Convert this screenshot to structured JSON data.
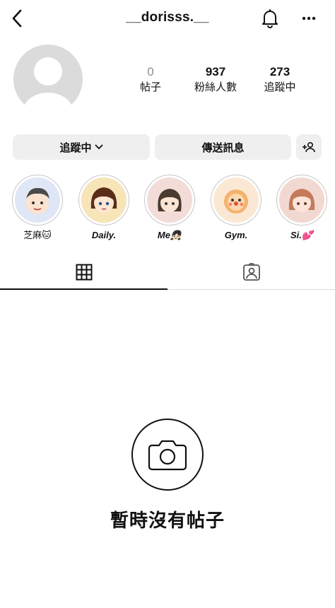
{
  "header": {
    "username": "__dorisss.__",
    "back_icon": "chevron-left-icon",
    "bell_icon": "bell-icon",
    "more_icon": "more-horizontal-icon"
  },
  "profile": {
    "avatar_icon": "default-avatar-icon",
    "stats": [
      {
        "value": "0",
        "label": "帖子"
      },
      {
        "value": "937",
        "label": "粉絲人數"
      },
      {
        "value": "273",
        "label": "追蹤中"
      }
    ]
  },
  "actions": {
    "follow_label": "追蹤中",
    "message_label": "傳送訊息",
    "add_user_icon": "add-user-icon"
  },
  "highlights": [
    {
      "caption": "芝麻🐱",
      "italic": false,
      "bg": "#dfe6f6"
    },
    {
      "caption": "Daily.",
      "italic": true,
      "bg": "#f7e4b7"
    },
    {
      "caption": "Me👧🏻",
      "italic": true,
      "bg": "#f3dcd8"
    },
    {
      "caption": "Gym.",
      "italic": true,
      "bg": "#fbe8d4"
    },
    {
      "caption": "Si.💕",
      "italic": true,
      "bg": "#f1d9d1"
    }
  ],
  "tabs": [
    {
      "name": "grid",
      "icon": "grid-icon",
      "active": true
    },
    {
      "name": "tagged",
      "icon": "tagged-person-icon",
      "active": false
    }
  ],
  "empty_state": {
    "icon": "camera-icon",
    "text": "暫時沒有帖子"
  }
}
